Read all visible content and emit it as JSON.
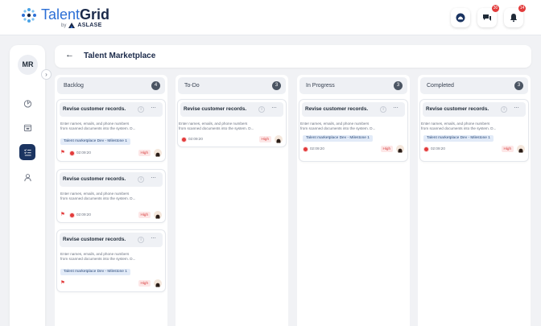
{
  "brand": {
    "name_part1": "Talent",
    "name_part2": "Grid",
    "by_label": "by",
    "company": "ASLASE",
    "colors": {
      "primary": "#2c6fd6",
      "dark": "#1b2a4a",
      "alert": "#e23b3b"
    }
  },
  "header_icons": [
    {
      "name": "profile-icon",
      "badge": ""
    },
    {
      "name": "chat-icon",
      "badge": "30"
    },
    {
      "name": "bell-icon",
      "badge": "14"
    }
  ],
  "sidebar": {
    "avatar_initials": "MR",
    "collapse_icon": "chevron-right-icon",
    "items": [
      {
        "name": "dashboard-icon",
        "active": false
      },
      {
        "name": "calendar-icon",
        "active": false
      },
      {
        "name": "tasks-list-icon",
        "active": true
      },
      {
        "name": "user-icon",
        "active": false
      }
    ]
  },
  "page": {
    "back_icon": "arrow-left-icon",
    "back_symbol": "←",
    "title": "Talent Marketplace"
  },
  "columns": [
    {
      "title": "Backlog",
      "count": "4",
      "cards": [
        {
          "title": "Revise customer records.",
          "info": "i",
          "menu": "···",
          "desc_line1": "Enter names, emails, and phone numbers",
          "desc_line2": "from scanned documents into the system. D...",
          "tag": "Talent marketplace Dev - Milestone 1",
          "flag": true,
          "timer": "02:09:20",
          "priority": "High"
        },
        {
          "title": "Revise customer records.",
          "info": "i",
          "menu": "···",
          "desc_line1": "Enter names, emails, and phone numbers",
          "desc_line2": "from scanned documents into the system. D...",
          "tag": "",
          "flag": true,
          "timer": "02:09:20",
          "priority": "High"
        },
        {
          "title": "Revise customer records.",
          "info": "i",
          "menu": "···",
          "desc_line1": "Enter names, emails, and phone numbers",
          "desc_line2": "from scanned documents into the system. D...",
          "tag": "Talent marketplace Dev - Milestone 1",
          "flag": true,
          "timer": "",
          "priority": "High"
        }
      ]
    },
    {
      "title": "To-Do",
      "count": "3",
      "cards": [
        {
          "title": "Revise customer records.",
          "info": "i",
          "menu": "···",
          "desc_line1": "Enter names, emails, and phone numbers",
          "desc_line2": "from scanned documents into the system. D...",
          "tag": "",
          "flag": false,
          "timer": "02:09:20",
          "priority": "High"
        }
      ]
    },
    {
      "title": "In Progress",
      "count": "3",
      "cards": [
        {
          "title": "Revise customer records.",
          "info": "i",
          "menu": "···",
          "desc_line1": "Enter names, emails, and phone numbers",
          "desc_line2": "from scanned documents into the system. D...",
          "tag": "Talent marketplace Dev - Milestone 1",
          "flag": false,
          "timer": "02:09:20",
          "priority": "High"
        }
      ]
    },
    {
      "title": "Completed",
      "count": "3",
      "cards": [
        {
          "title": "Revise customer records.",
          "info": "i",
          "menu": "···",
          "desc_line1": "Enter names, emails, and phone numbers",
          "desc_line2": "from scanned documents into the system. D...",
          "tag": "Talent marketplace Dev - Milestone 1",
          "flag": false,
          "timer": "02:09:20",
          "priority": "High"
        }
      ]
    }
  ]
}
